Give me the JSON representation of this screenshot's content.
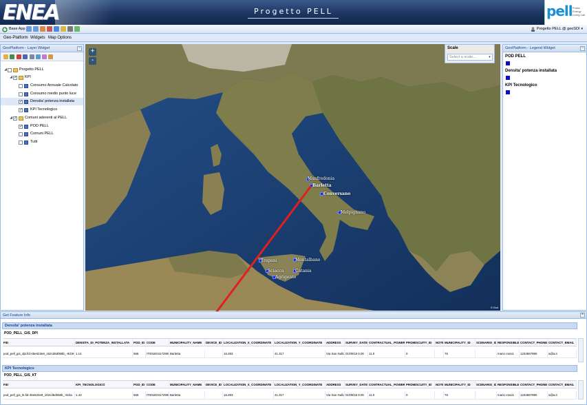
{
  "header": {
    "brand": "ENEA",
    "title": "Progetto PELL",
    "partner_logo": {
      "word": "pell",
      "sub": "Public Energy Living Lab"
    }
  },
  "toolbar": {
    "base_app_label": "Base App",
    "user_label": "Progetto PELL @ geoSDI",
    "icons": [
      "zoom-in-icon",
      "zoom-out-icon",
      "pan-icon",
      "measure-icon",
      "info-icon",
      "home-icon",
      "print-icon",
      "export-icon"
    ]
  },
  "menubar": {
    "items": [
      "Geo-Platform",
      "Widgets",
      "Map Options"
    ]
  },
  "layer_widget": {
    "title": "GeoPlatform - Layer Widget",
    "tree": [
      {
        "label": "Progetto PELL",
        "level": 0,
        "checked": false,
        "kind": "folder"
      },
      {
        "label": "KPI",
        "level": 1,
        "checked": true,
        "kind": "folder"
      },
      {
        "label": "Consumo Annuale Calcolato",
        "level": 2,
        "checked": false,
        "kind": "layer"
      },
      {
        "label": "Consumo medio punto luce",
        "level": 2,
        "checked": false,
        "kind": "layer"
      },
      {
        "label": "Densita' potenza installata",
        "level": 2,
        "checked": true,
        "kind": "layer",
        "selected": true
      },
      {
        "label": "KPI Tecnologico",
        "level": 2,
        "checked": true,
        "kind": "layer"
      },
      {
        "label": "Comuni aderenti al PELL",
        "level": 1,
        "checked": true,
        "kind": "folder"
      },
      {
        "label": "POD PELL",
        "level": 2,
        "checked": true,
        "kind": "layer"
      },
      {
        "label": "Comuni PELL",
        "level": 2,
        "checked": false,
        "kind": "layer"
      },
      {
        "label": "Tutti",
        "level": 2,
        "checked": false,
        "kind": "layer"
      }
    ]
  },
  "map": {
    "zoom_in": "+",
    "zoom_out": "-",
    "scale_label": "Scale",
    "scale_placeholder": "Select a scale...",
    "attribution": "© Esri",
    "cities": [
      {
        "name": "Manfredonia"
      },
      {
        "name": "Barletta"
      },
      {
        "name": "Conversano"
      },
      {
        "name": "Melpignano"
      },
      {
        "name": "Trapani"
      },
      {
        "name": "Montalbano"
      },
      {
        "name": "Sciacca"
      },
      {
        "name": "Catania"
      },
      {
        "name": "Agrigento"
      }
    ]
  },
  "legend_widget": {
    "title": "GeoPlatform - Legend Widget",
    "entries": [
      "POD PELL",
      "Densita' potenza installata",
      "KPI Tecnologico"
    ],
    "swatch_color": "#0a0cd6"
  },
  "feature_info": {
    "title": "Get Feature Info",
    "groups": [
      {
        "title": "Densita' potenza installata",
        "layer": "POD_PELL_GIS_DPI",
        "columns": [
          "FID",
          "DENSITA_DI_POTENZA_INSTALLATA",
          "POD_ID",
          "CODE",
          "MUNICIPALITY_NAME",
          "DEVICE_ID",
          "LOCALIZATION_X_COORDINATE",
          "LOCALIZATION_Y_COORDINATE",
          "ADDRESS",
          "SURVEY_DATE",
          "CONTRACTUAL_POWER",
          "PROMISCUITY_ID",
          "NOTE",
          "MUNICIPALITY_ID",
          "SCENARIO_ID",
          "RESPONSIBLE",
          "CONTACT_PHONE",
          "CONTACT_EMAIL"
        ],
        "rows": [
          [
            "pod_pell_gis_dpi.fid-45e623e8_162cd6d068b_-8cb9",
            "1.14",
            "566",
            "IT001E04172906",
            "Barletta",
            "",
            "16.283",
            "41.317",
            "Via San Nullo",
            "01/09/15 0.00",
            "11.0",
            "0",
            "",
            "76",
            "",
            "mario rossi1",
            "1234567890",
            "a@a.it"
          ]
        ]
      },
      {
        "title": "KPI Tecnologico",
        "layer": "POD_PELL_GIS_KT",
        "columns": [
          "FID",
          "KPI_TECNOLOGICO",
          "POD_ID",
          "CODE",
          "MUNICIPALITY_NAME",
          "DEVICE_ID",
          "LOCALIZATION_X_COORDINATE",
          "LOCALIZATION_Y_COORDINATE",
          "ADDRESS",
          "SURVEY_DATE",
          "CONTRACTUAL_POWER",
          "PROMISCUITY_ID",
          "NOTE",
          "MUNICIPALITY_ID",
          "SCENARIO_ID",
          "RESPONSIBLE",
          "CONTACT_PHONE",
          "CONTACT_EMAIL"
        ],
        "rows": [
          [
            "pod_pell_gis_kt.fid-45e623e8_162cd6d068b_-8cba",
            "1.43",
            "566",
            "IT001E04172906",
            "Barletta",
            "",
            "16.283",
            "41.317",
            "Via San Nullo",
            "01/09/15 0.00",
            "11.0",
            "0",
            "",
            "76",
            "",
            "mario rossi1",
            "1234567890",
            "a@a.it"
          ]
        ]
      }
    ]
  }
}
